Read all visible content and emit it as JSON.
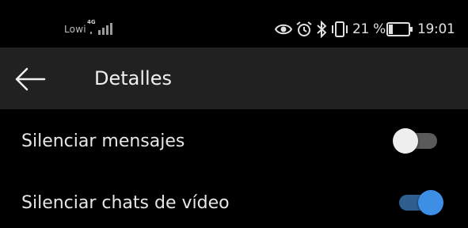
{
  "status_bar": {
    "carrier": "Lowi",
    "network_type": "4G",
    "signal_icon": "signal-bars-icon",
    "icons": [
      "eye-icon",
      "alarm-icon",
      "bluetooth-icon",
      "vibrate-icon"
    ],
    "battery_percent": "21 %",
    "battery_level": 0.21,
    "time": "19:01"
  },
  "toolbar": {
    "back_icon": "arrow-left-icon",
    "title": "Detalles"
  },
  "settings": [
    {
      "label": "Silenciar mensajes",
      "enabled": false
    },
    {
      "label": "Silenciar chats de vídeo",
      "enabled": true
    }
  ],
  "colors": {
    "background": "#000000",
    "toolbar": "#212121",
    "toggle_on_thumb": "#3d8fe6",
    "toggle_on_track": "#2f5f8f",
    "toggle_off_thumb": "#eeeeee",
    "toggle_off_track": "#5a5a5a"
  }
}
